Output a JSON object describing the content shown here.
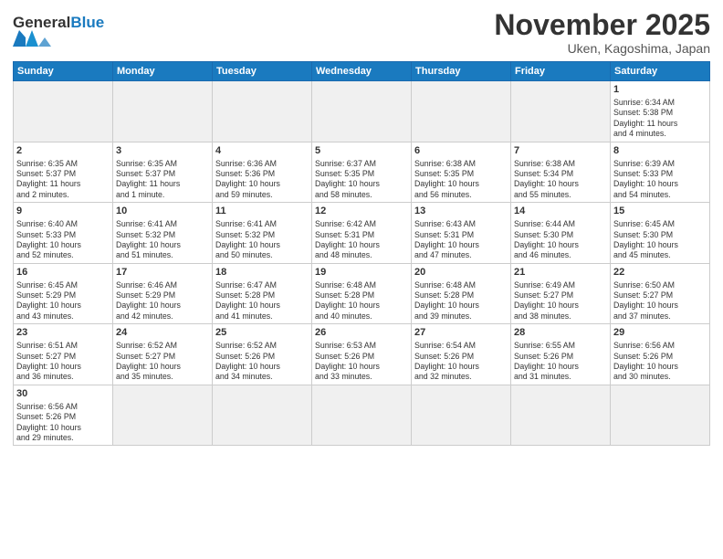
{
  "header": {
    "logo_general": "General",
    "logo_blue": "Blue",
    "month_title": "November 2025",
    "location": "Uken, Kagoshima, Japan"
  },
  "weekdays": [
    "Sunday",
    "Monday",
    "Tuesday",
    "Wednesday",
    "Thursday",
    "Friday",
    "Saturday"
  ],
  "weeks": [
    [
      {
        "day": "",
        "info": ""
      },
      {
        "day": "",
        "info": ""
      },
      {
        "day": "",
        "info": ""
      },
      {
        "day": "",
        "info": ""
      },
      {
        "day": "",
        "info": ""
      },
      {
        "day": "",
        "info": ""
      },
      {
        "day": "1",
        "info": "Sunrise: 6:34 AM\nSunset: 5:38 PM\nDaylight: 11 hours\nand 4 minutes."
      }
    ],
    [
      {
        "day": "2",
        "info": "Sunrise: 6:35 AM\nSunset: 5:37 PM\nDaylight: 11 hours\nand 2 minutes."
      },
      {
        "day": "3",
        "info": "Sunrise: 6:35 AM\nSunset: 5:37 PM\nDaylight: 11 hours\nand 1 minute."
      },
      {
        "day": "4",
        "info": "Sunrise: 6:36 AM\nSunset: 5:36 PM\nDaylight: 10 hours\nand 59 minutes."
      },
      {
        "day": "5",
        "info": "Sunrise: 6:37 AM\nSunset: 5:35 PM\nDaylight: 10 hours\nand 58 minutes."
      },
      {
        "day": "6",
        "info": "Sunrise: 6:38 AM\nSunset: 5:35 PM\nDaylight: 10 hours\nand 56 minutes."
      },
      {
        "day": "7",
        "info": "Sunrise: 6:38 AM\nSunset: 5:34 PM\nDaylight: 10 hours\nand 55 minutes."
      },
      {
        "day": "8",
        "info": "Sunrise: 6:39 AM\nSunset: 5:33 PM\nDaylight: 10 hours\nand 54 minutes."
      }
    ],
    [
      {
        "day": "9",
        "info": "Sunrise: 6:40 AM\nSunset: 5:33 PM\nDaylight: 10 hours\nand 52 minutes."
      },
      {
        "day": "10",
        "info": "Sunrise: 6:41 AM\nSunset: 5:32 PM\nDaylight: 10 hours\nand 51 minutes."
      },
      {
        "day": "11",
        "info": "Sunrise: 6:41 AM\nSunset: 5:32 PM\nDaylight: 10 hours\nand 50 minutes."
      },
      {
        "day": "12",
        "info": "Sunrise: 6:42 AM\nSunset: 5:31 PM\nDaylight: 10 hours\nand 48 minutes."
      },
      {
        "day": "13",
        "info": "Sunrise: 6:43 AM\nSunset: 5:31 PM\nDaylight: 10 hours\nand 47 minutes."
      },
      {
        "day": "14",
        "info": "Sunrise: 6:44 AM\nSunset: 5:30 PM\nDaylight: 10 hours\nand 46 minutes."
      },
      {
        "day": "15",
        "info": "Sunrise: 6:45 AM\nSunset: 5:30 PM\nDaylight: 10 hours\nand 45 minutes."
      }
    ],
    [
      {
        "day": "16",
        "info": "Sunrise: 6:45 AM\nSunset: 5:29 PM\nDaylight: 10 hours\nand 43 minutes."
      },
      {
        "day": "17",
        "info": "Sunrise: 6:46 AM\nSunset: 5:29 PM\nDaylight: 10 hours\nand 42 minutes."
      },
      {
        "day": "18",
        "info": "Sunrise: 6:47 AM\nSunset: 5:28 PM\nDaylight: 10 hours\nand 41 minutes."
      },
      {
        "day": "19",
        "info": "Sunrise: 6:48 AM\nSunset: 5:28 PM\nDaylight: 10 hours\nand 40 minutes."
      },
      {
        "day": "20",
        "info": "Sunrise: 6:48 AM\nSunset: 5:28 PM\nDaylight: 10 hours\nand 39 minutes."
      },
      {
        "day": "21",
        "info": "Sunrise: 6:49 AM\nSunset: 5:27 PM\nDaylight: 10 hours\nand 38 minutes."
      },
      {
        "day": "22",
        "info": "Sunrise: 6:50 AM\nSunset: 5:27 PM\nDaylight: 10 hours\nand 37 minutes."
      }
    ],
    [
      {
        "day": "23",
        "info": "Sunrise: 6:51 AM\nSunset: 5:27 PM\nDaylight: 10 hours\nand 36 minutes."
      },
      {
        "day": "24",
        "info": "Sunrise: 6:52 AM\nSunset: 5:27 PM\nDaylight: 10 hours\nand 35 minutes."
      },
      {
        "day": "25",
        "info": "Sunrise: 6:52 AM\nSunset: 5:26 PM\nDaylight: 10 hours\nand 34 minutes."
      },
      {
        "day": "26",
        "info": "Sunrise: 6:53 AM\nSunset: 5:26 PM\nDaylight: 10 hours\nand 33 minutes."
      },
      {
        "day": "27",
        "info": "Sunrise: 6:54 AM\nSunset: 5:26 PM\nDaylight: 10 hours\nand 32 minutes."
      },
      {
        "day": "28",
        "info": "Sunrise: 6:55 AM\nSunset: 5:26 PM\nDaylight: 10 hours\nand 31 minutes."
      },
      {
        "day": "29",
        "info": "Sunrise: 6:56 AM\nSunset: 5:26 PM\nDaylight: 10 hours\nand 30 minutes."
      }
    ],
    [
      {
        "day": "30",
        "info": "Sunrise: 6:56 AM\nSunset: 5:26 PM\nDaylight: 10 hours\nand 29 minutes."
      },
      {
        "day": "",
        "info": ""
      },
      {
        "day": "",
        "info": ""
      },
      {
        "day": "",
        "info": ""
      },
      {
        "day": "",
        "info": ""
      },
      {
        "day": "",
        "info": ""
      },
      {
        "day": "",
        "info": ""
      }
    ]
  ]
}
